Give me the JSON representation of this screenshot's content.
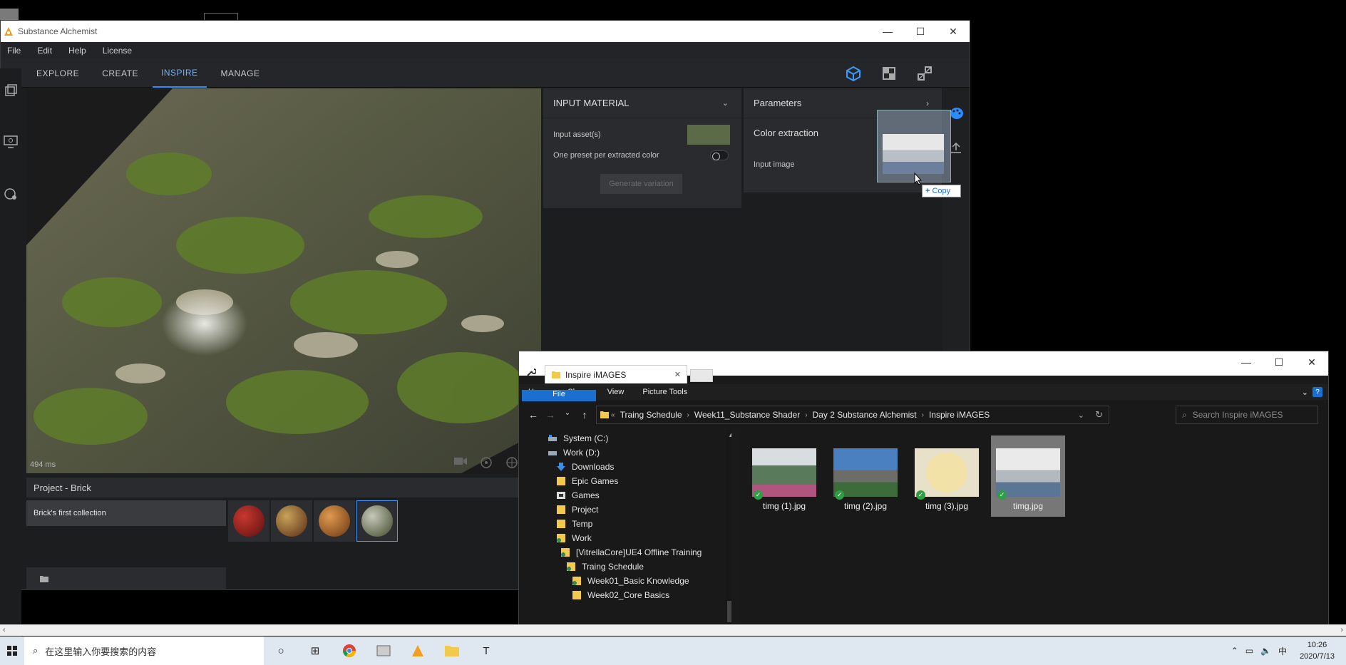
{
  "colors": {
    "accent": "#2a8cff",
    "sa_bg": "#1c1d1f",
    "file_tab": "#1a6fcf"
  },
  "alchemist": {
    "title": "Substance Alchemist",
    "menu": [
      "File",
      "Edit",
      "Help",
      "License"
    ],
    "tabs": [
      "EXPLORE",
      "CREATE",
      "INSPIRE",
      "MANAGE"
    ],
    "active_tab": "INSPIRE",
    "viewport_time": "494 ms",
    "project_title": "Project - Brick",
    "collection_name": "Brick's first collection",
    "input_material": {
      "header": "INPUT MATERIAL",
      "input_assets": "Input asset(s)",
      "one_preset": "One preset per extracted color",
      "generate": "Generate variation"
    },
    "parameters": {
      "header": "Parameters",
      "color_extraction": "Color extraction",
      "input_image": "Input image"
    },
    "drag_tooltip": "Copy"
  },
  "explorer": {
    "tab_title": "Inspire iMAGES",
    "ribbon": [
      "File",
      "Home",
      "Share",
      "View",
      "Picture Tools"
    ],
    "breadcrumb": [
      "Traing Schedule",
      "Week11_Substance Shader",
      "Day 2 Substance Alchemist",
      "Inspire iMAGES"
    ],
    "search_placeholder": "Search Inspire iMAGES",
    "nav": [
      "System (C:)",
      "Work (D:)",
      "Downloads",
      "Epic Games",
      "Games",
      "Project",
      "Temp",
      "Work",
      "[VitrellaCore]UE4 Offline Training",
      "Traing Schedule",
      "Week01_Basic Knowledge",
      "Week02_Core Basics"
    ],
    "files": [
      "timg (1).jpg",
      "timg (2).jpg",
      "timg (3).jpg",
      "timg.jpg"
    ],
    "selected_file": "timg.jpg"
  },
  "taskbar": {
    "search_placeholder": "在这里输入你要搜索的内容",
    "time": "10:26",
    "date": "2020/7/13",
    "ime": "中"
  }
}
